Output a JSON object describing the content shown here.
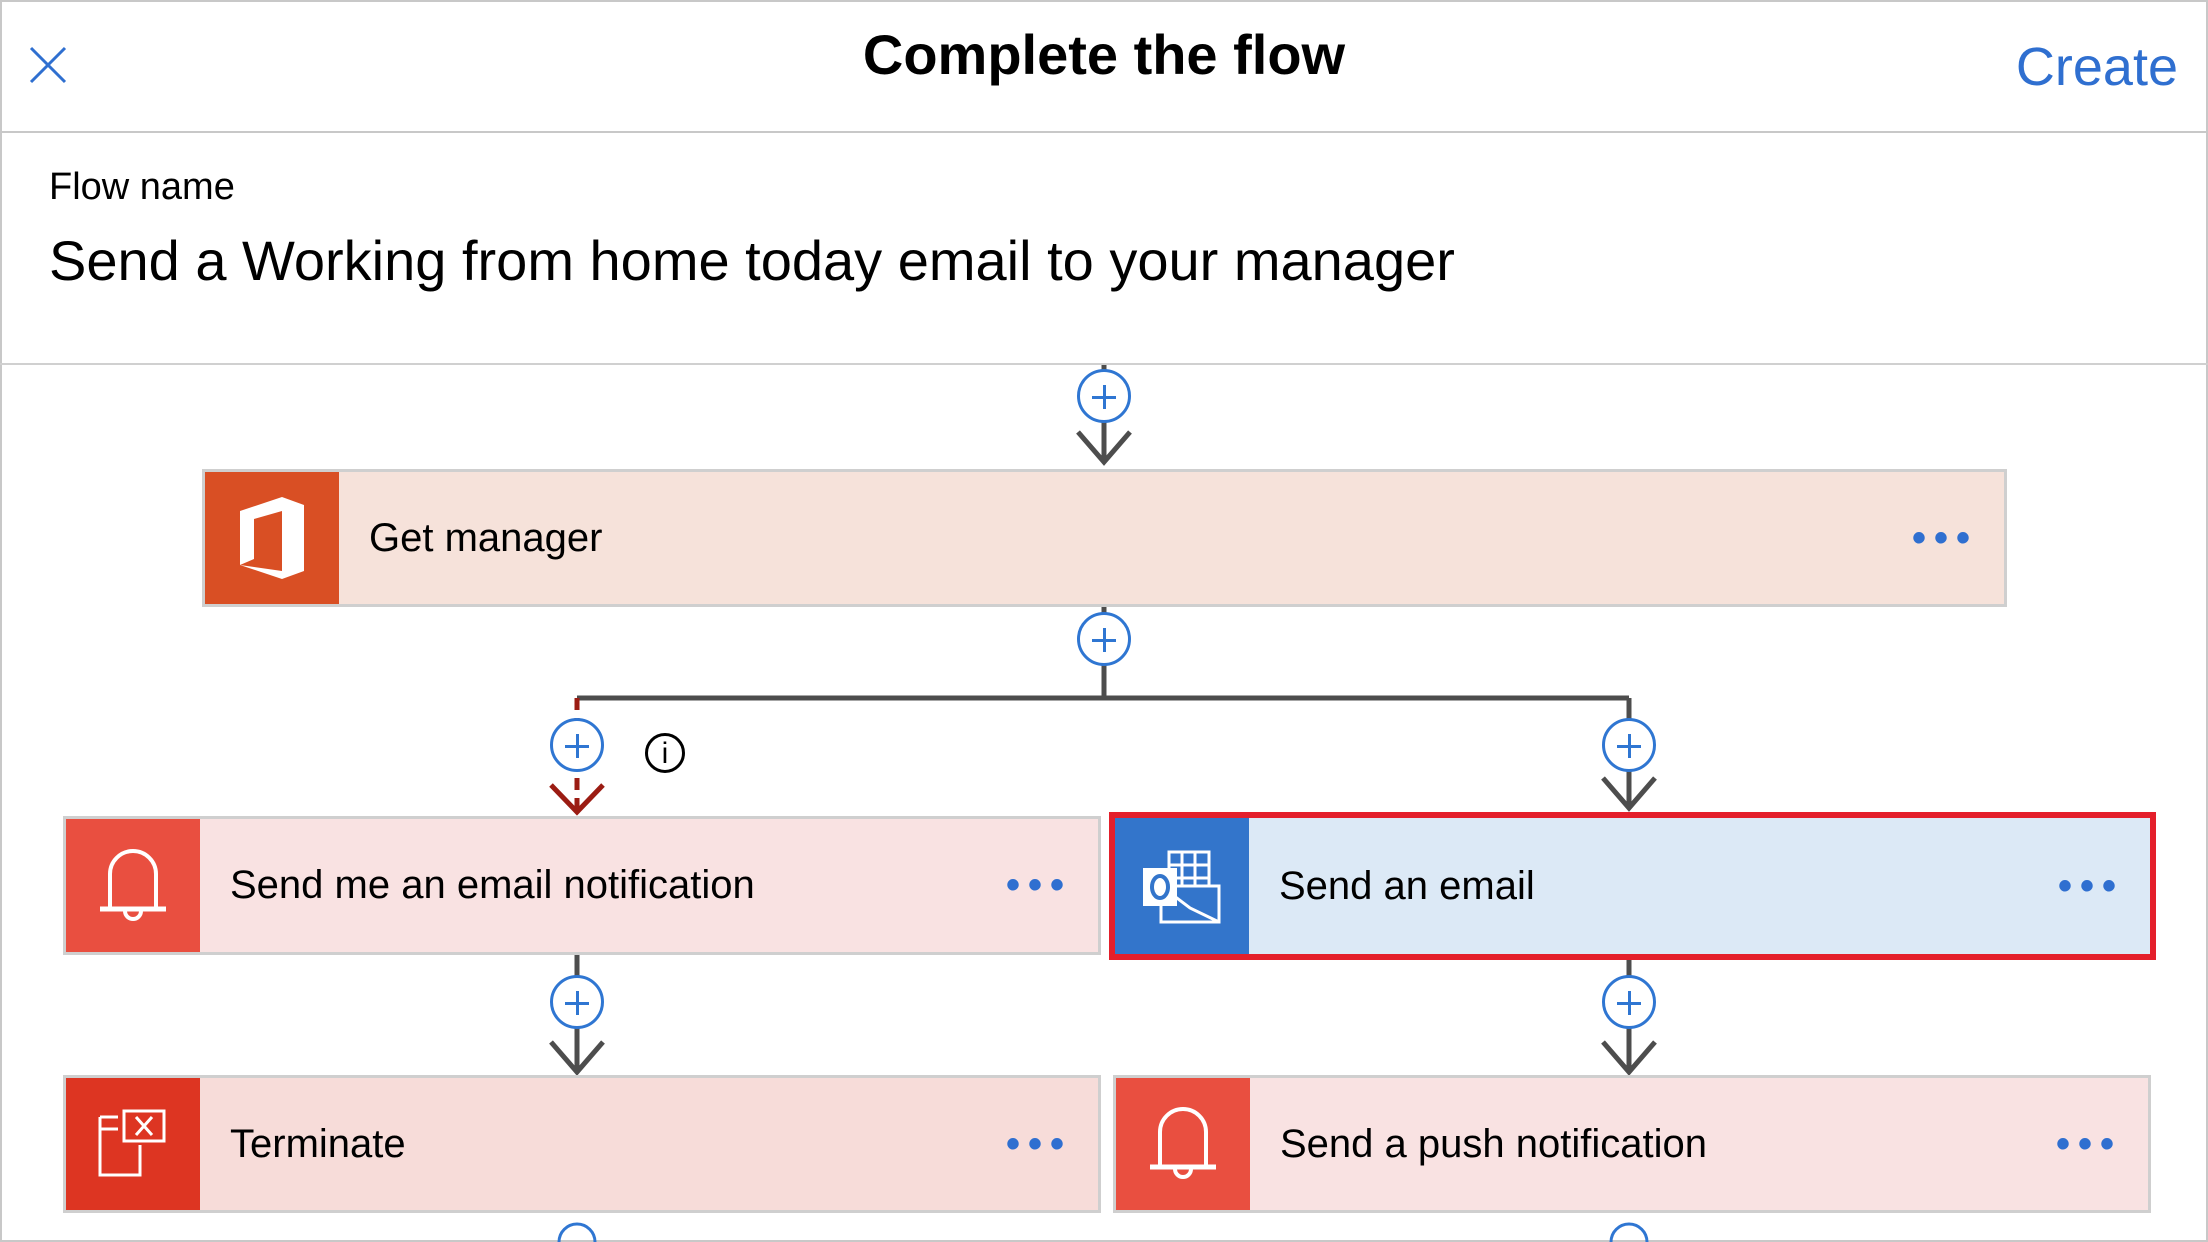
{
  "header": {
    "title": "Complete the flow",
    "create_label": "Create",
    "close_icon": "close-icon"
  },
  "flow_name": {
    "label": "Flow name",
    "value": "Send a Working from home today email to your manager"
  },
  "steps": [
    {
      "label": "Get manager",
      "icon": "office-icon",
      "more": "•••",
      "bg": "#f6e2da",
      "icon_bg": "#d94f24"
    },
    {
      "label": "Send me an email notification",
      "icon": "bell-icon",
      "more": "•••",
      "bg": "#f9e2e2",
      "icon_bg": "#e94f40"
    },
    {
      "label": "Send an email",
      "icon": "outlook-icon",
      "more": "•••",
      "bg": "#dce9f6",
      "icon_bg": "#3375cb",
      "selected": true
    },
    {
      "label": "Terminate",
      "icon": "terminate-icon",
      "more": "•••",
      "bg": "#f7dcd9",
      "icon_bg": "#dd3522"
    },
    {
      "label": "Send a push notification",
      "icon": "bell-icon",
      "more": "•••",
      "bg": "#f9e2e2",
      "icon_bg": "#e94f40"
    }
  ],
  "info_label": "i",
  "colors": {
    "accent": "#2f6fd0",
    "selection": "#e41f2b",
    "error_path": "#9b1c13",
    "connector": "#4d4d4d"
  }
}
